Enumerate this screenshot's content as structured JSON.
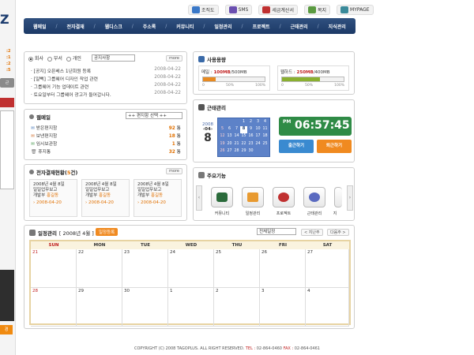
{
  "left_strip": {
    "logo_text": "Z",
    "counts": [
      ":2",
      ":1",
      ":2",
      ":5",
      ":1"
    ],
    "button_label": "근",
    "bottom_label": "경"
  },
  "top_links": [
    {
      "label": "조직도",
      "icon": "org-chart-icon",
      "color": "#3a78c8"
    },
    {
      "label": "SMS",
      "icon": "sms-icon",
      "color": "#6a4fb0"
    },
    {
      "label": "세금계산서",
      "icon": "tax-invoice-icon",
      "color": "#c03030"
    },
    {
      "label": "목지",
      "icon": "note-icon",
      "color": "#5a9a40"
    },
    {
      "label": "MYPAGE",
      "icon": "mypage-icon",
      "color": "#3a8a9a"
    }
  ],
  "nav": [
    "웹메일",
    "전자결재",
    "웹디스크",
    "주소록",
    "커뮤니티",
    "일정관리",
    "프로젝트",
    "근태관리",
    "지식관리"
  ],
  "notice": {
    "radios": [
      "회사",
      "부서",
      "개인"
    ],
    "select_value": "공지사항",
    "more": "more",
    "items": [
      {
        "text": "· [공지] 오픈베스 1년회원 등록",
        "date": "2008-04-22"
      },
      {
        "text": "· [일뻑] 그룹웨어 디자인 작업 관련",
        "date": "2008-04-22"
      },
      {
        "text": "· 그룹웨어 기능 업데이트 관련",
        "date": "2008-04-22"
      },
      {
        "text": "· 토요일부터 그룹웨어 광고가 들어갑니다.",
        "date": "2008-04-22"
      }
    ]
  },
  "webmail": {
    "title": "웹메일",
    "select_value": "++ 편지함 선택 ++",
    "items": [
      {
        "label": "받은편지함",
        "count": "92",
        "unit": "통"
      },
      {
        "label": "보낸편지함",
        "count": "18",
        "unit": "통"
      },
      {
        "label": "임시보관함",
        "count": "1",
        "unit": "통"
      },
      {
        "label": "휴지통",
        "count": "32",
        "unit": "통"
      }
    ]
  },
  "approval": {
    "title": "전자결재현황(",
    "count": "5",
    "title_end": "건)",
    "more": "more",
    "cards": [
      {
        "line1": "2008년 4월 8일",
        "line2": "일일업무보고",
        "dept": "개발부",
        "name": "홍길동",
        "date": "2008-04-20"
      },
      {
        "line1": "2008년 4월 8일",
        "line2": "일일업무보고",
        "dept": "개발부",
        "name": "홍길동",
        "date": "2008-04-20"
      },
      {
        "line1": "2008년 4월 8일",
        "line2": "일일업무보고",
        "dept": "개발부",
        "name": "홍길동",
        "date": "2008-04-20"
      }
    ]
  },
  "usage": {
    "title": "사용용량",
    "mail": {
      "label": "메일 :",
      "used": "100MB",
      "total": "/500MB",
      "fraction": 0.2,
      "color": "#e88a20"
    },
    "disk": {
      "label": "웹하드 :",
      "used": "250MB",
      "total": "/400MB",
      "fraction": 0.62,
      "color": "#8ab030"
    },
    "ticks": [
      "0",
      "50%",
      "100%"
    ]
  },
  "attendance": {
    "title": "근태관리",
    "year": "2008",
    "month": "04",
    "day": "8",
    "calendar": [
      "",
      "",
      "",
      "1",
      "2",
      "3",
      "4",
      "5",
      "6",
      "7",
      "8",
      "9",
      "10",
      "11",
      "12",
      "13",
      "14",
      "15",
      "16",
      "17",
      "18",
      "19",
      "20",
      "21",
      "22",
      "23",
      "24",
      "25",
      "26",
      "27",
      "28",
      "29",
      "30",
      "",
      ""
    ],
    "highlight_day": "8",
    "clock_ampm": "PM",
    "clock_time": "06:57:45",
    "btn_in": "출근하기",
    "btn_out": "퇴근하기"
  },
  "features": {
    "title": "주요기능",
    "items": [
      "커뮤니티",
      "일정관리",
      "프로젝트",
      "근태관리",
      "지"
    ]
  },
  "schedule": {
    "title": "일정관리",
    "month_label": "[ 2008년 4월 ]",
    "button": "일정등록",
    "select_value": "전체일정",
    "prev": "< 지난주",
    "next": "다음주 >",
    "days": [
      "SUN",
      "MON",
      "TUE",
      "WED",
      "THU",
      "FRI",
      "SAT"
    ],
    "week1": [
      "21",
      "22",
      "23",
      "24",
      "25",
      "26",
      "27"
    ],
    "week2": [
      "28",
      "29",
      "30",
      "1",
      "2",
      "3",
      "4"
    ]
  },
  "footer": {
    "copyright": "COPYRIGHT (C) 2008 TAGOPLUS. ALL RIGHT RESERVED.",
    "tel_label": "TEL :",
    "tel": "02-864-0460",
    "fax_label": "FAX :",
    "fax": "02-864-0461"
  },
  "colors": {
    "nav_bg": "#1c3966",
    "accent_orange": "#e07000",
    "clock_green": "#2f8b46"
  }
}
